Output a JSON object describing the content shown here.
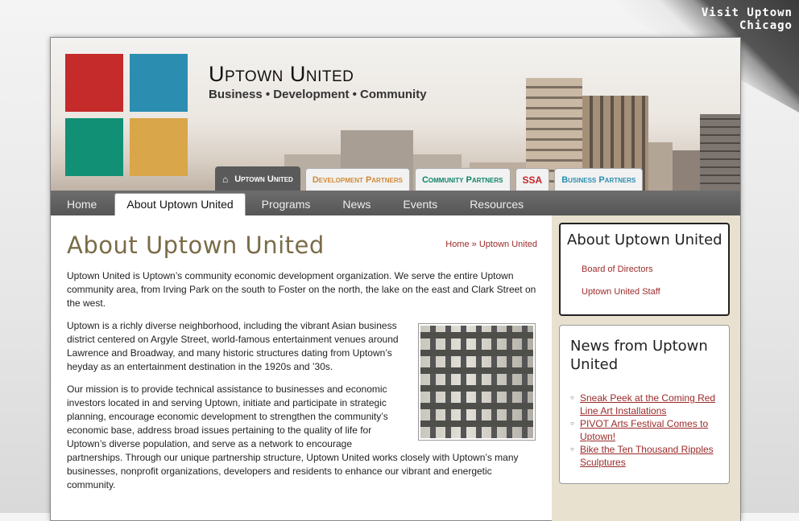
{
  "corner": {
    "text": "Visit Uptown Chicago"
  },
  "header": {
    "brand": "Uptown United",
    "tagline": "Business • Development • Community"
  },
  "partner_tabs": [
    {
      "label": "Uptown United",
      "active": true
    },
    {
      "label": "Development Partners",
      "color": "#d08a34"
    },
    {
      "label": "Community Partners",
      "color": "#0e8468"
    },
    {
      "label": "SSA",
      "color": "#c4262a"
    },
    {
      "label": "Business Partners",
      "color": "#2b8db0"
    }
  ],
  "nav": {
    "items": [
      "Home",
      "About Uptown United",
      "Programs",
      "News",
      "Events",
      "Resources"
    ],
    "active": "About Uptown United"
  },
  "main": {
    "title": "About Uptown United",
    "breadcrumb": {
      "home": "Home",
      "sep": "»",
      "current": "Uptown United"
    },
    "paragraphs": [
      "Uptown United is Uptown’s community economic development organization. We serve the entire Uptown community area, from Irving Park on the south to Foster on the north, the lake on the east and Clark Street on the west.",
      "Uptown is a richly diverse neighborhood, including the vibrant Asian business district centered on Argyle Street, world-famous entertainment venues around Lawrence and Broadway, and many historic structures dating from Uptown’s heyday as an entertainment destination in the 1920s and ’30s.",
      "Our mission is to provide technical assistance to businesses and economic investors located in and serving Uptown, initiate and participate in strategic planning, encourage economic development to strengthen the community’s economic base, address broad issues pertaining to the quality of life for Uptown’s diverse population, and serve as a network to encourage partnerships.   Through our unique partnership structure, Uptown United works closely with Uptown’s many businesses, nonprofit organizations, developers and residents to enhance our vibrant and energetic community."
    ]
  },
  "sidebar": {
    "about": {
      "title": "About Uptown United",
      "links": [
        "Board of Directors",
        "Uptown United Staff"
      ]
    },
    "news": {
      "title": "News from Uptown United",
      "links": [
        "Sneak Peek at the Coming Red Line Art Installations",
        "PIVOT Arts Festival Comes to Uptown!",
        "Bike the Ten Thousand Ripples Sculptures"
      ]
    }
  },
  "colors": {
    "brand_red": "#c42b2a",
    "brand_blue": "#2b8db0",
    "brand_green": "#119075",
    "brand_gold": "#d9a64a",
    "link": "#9c2a2a"
  }
}
